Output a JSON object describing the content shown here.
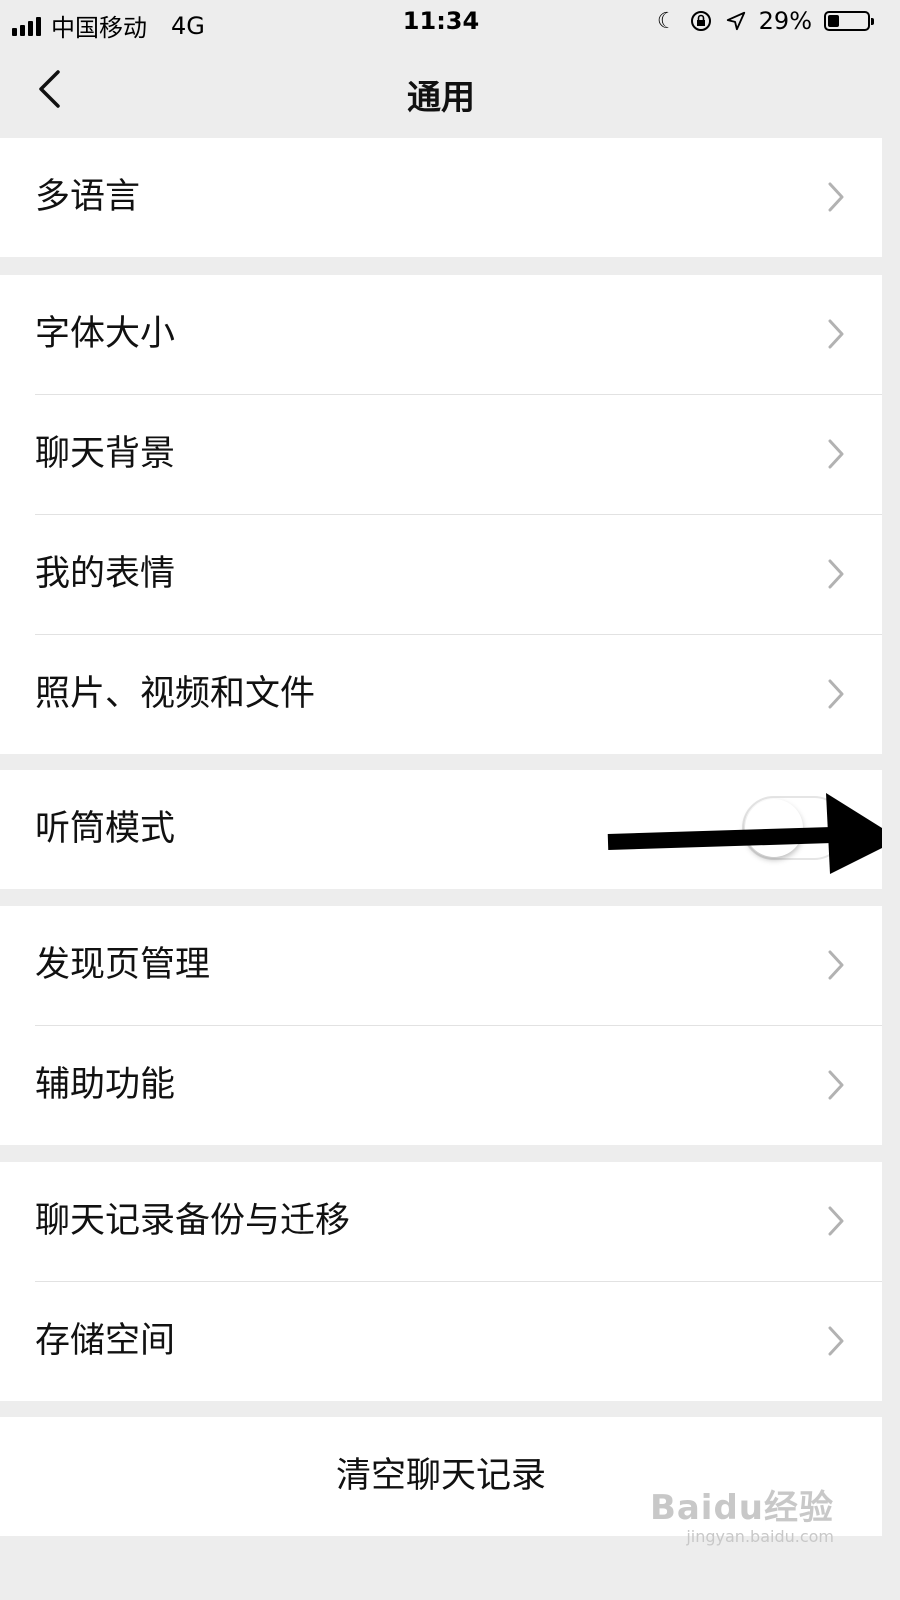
{
  "status_bar": {
    "carrier": "中国移动",
    "network": "4G",
    "time": "11:34",
    "battery_percent": "29%",
    "battery_level": 0.29,
    "icons": [
      "signal-icon",
      "moon-icon",
      "rotation-lock-icon",
      "location-icon",
      "battery-icon"
    ]
  },
  "nav": {
    "title": "通用",
    "back_icon": "back-chevron-icon"
  },
  "groups": {
    "language": {
      "items": [
        "多语言"
      ]
    },
    "display": {
      "items": [
        "字体大小",
        "聊天背景",
        "我的表情",
        "照片、视频和文件"
      ]
    },
    "earpiece": {
      "label": "听筒模式",
      "toggle_on": false
    },
    "features": {
      "items": [
        "发现页管理",
        "辅助功能"
      ]
    },
    "storage": {
      "items": [
        "聊天记录备份与迁移",
        "存储空间"
      ]
    },
    "clear": {
      "label": "清空聊天记录"
    }
  },
  "annotation": {
    "type": "arrow",
    "color": "#000000",
    "points_to": "earpiece-toggle"
  },
  "watermark": {
    "logo": "Baidu经验",
    "url": "jingyan.baidu.com"
  },
  "colors": {
    "background": "#ededed",
    "row_background": "#ffffff",
    "divider": "#e2e2e2",
    "chevron": "#b2b2b2",
    "text": "#111111"
  }
}
